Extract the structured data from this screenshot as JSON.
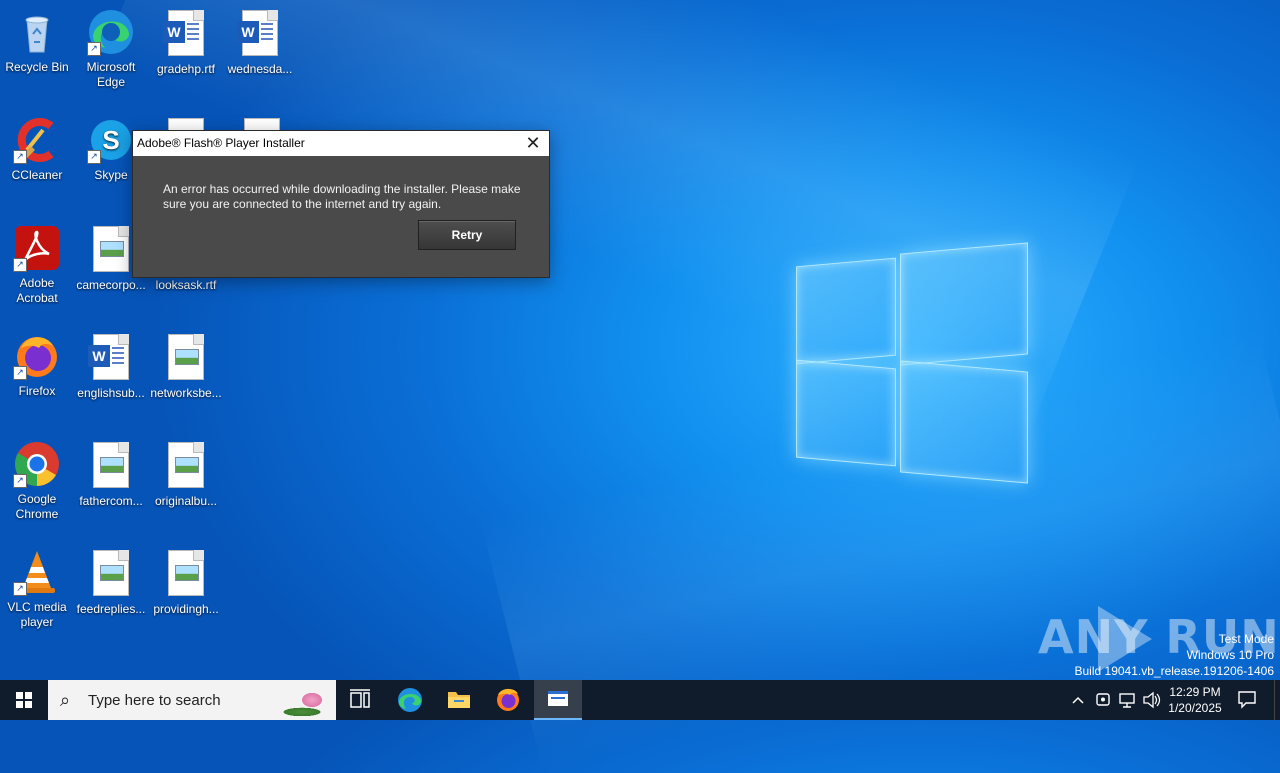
{
  "desktop": {
    "icons": [
      {
        "label": "Recycle Bin"
      },
      {
        "label": "Microsoft Edge"
      },
      {
        "label": "gradehp.rtf"
      },
      {
        "label": "wednesda..."
      },
      {
        "label": "CCleaner"
      },
      {
        "label": "Skype"
      },
      {
        "label": "Adobe Acrobat"
      },
      {
        "label": "camecorpo..."
      },
      {
        "label": "looksask.rtf"
      },
      {
        "label": "Firefox"
      },
      {
        "label": "englishsub..."
      },
      {
        "label": "networksbe..."
      },
      {
        "label": "Google Chrome"
      },
      {
        "label": "fathercom..."
      },
      {
        "label": "originalbu..."
      },
      {
        "label": "VLC media player"
      },
      {
        "label": "feedreplies..."
      },
      {
        "label": "providingh..."
      }
    ]
  },
  "dialog": {
    "title": "Adobe® Flash® Player Installer",
    "message": "An error has occurred while downloading the installer. Please make sure you are connected to the internet and try again.",
    "retry_label": "Retry",
    "close_icon": "close-icon"
  },
  "watermark": {
    "brand": "ANY RUN",
    "line1": "Test Mode",
    "line2": "Windows 10 Pro",
    "line3": "Build 19041.vb_release.191206-1406"
  },
  "taskbar": {
    "search_placeholder": "Type here to search",
    "clock_time": "12:29 PM",
    "clock_date": "1/20/2025",
    "pinned": [
      "task-view-icon",
      "edge-icon",
      "file-explorer-icon",
      "firefox-icon",
      "installer-window-icon"
    ]
  },
  "colors": {
    "desktop_blue": "#0a6fd6",
    "taskbar": "#101c2c",
    "dialog_bg": "#4a4a4a",
    "accent": "#6db7ff"
  }
}
